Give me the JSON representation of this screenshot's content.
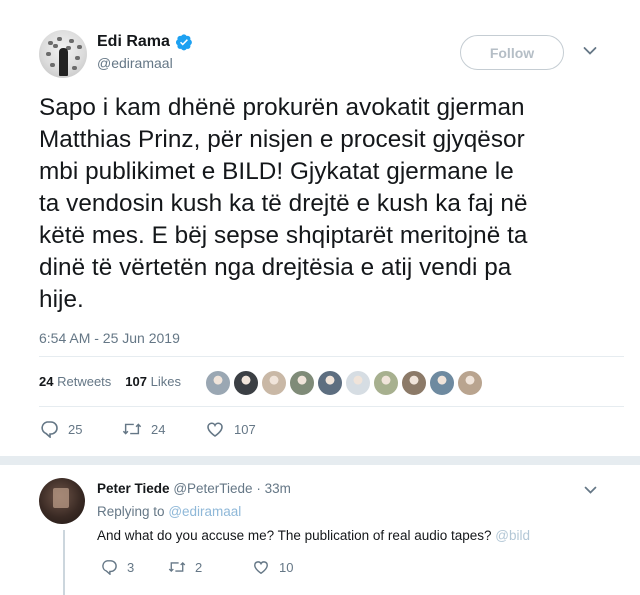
{
  "main_tweet": {
    "author_name": "Edi Rama",
    "handle": "@ediramaal",
    "follow_label": "Follow",
    "text_lines": [
      "Sapo i kam dhënë prokurën avokatit gjerman",
      "Matthias Prinz, për nisjen e procesit gjyqësor",
      "mbi publikimet e BILD! Gjykatat gjermane le",
      "ta vendosin kush ka të drejtë e kush ka faj në",
      "këtë mes. E bëj sepse shqiptarët meritojnë ta",
      "dinë të vërtetën nga drejtësia e atij vendi pa",
      "hije."
    ],
    "timestamp": "6:54 AM - 25 Jun 2019",
    "retweets_count": "24",
    "retweets_label": "Retweets",
    "likes_count": "107",
    "likes_label": "Likes",
    "actions": {
      "replies": "25",
      "retweets": "24",
      "likes": "107"
    },
    "liker_colors": [
      "#9aa7b3",
      "#3b3f44",
      "#c9b8a6",
      "#7f8b78",
      "#5d6e80",
      "#d6dde3",
      "#a7b08f",
      "#8c7a68",
      "#6e8aa0",
      "#b9a48f"
    ]
  },
  "reply": {
    "author_name": "Peter Tiede",
    "handle": "@PeterTiede",
    "time": "· 33m",
    "replying_label": "Replying to",
    "replying_to": "@ediramaal",
    "text": "And what do you accuse me?  The publication of real audio tapes?",
    "text_mention": "@bild",
    "actions": {
      "replies": "3",
      "retweets": "2",
      "likes": "10"
    }
  },
  "colors": {
    "verified": "#1da1f2",
    "icon": "#657786",
    "divider": "#e6ecf0"
  }
}
